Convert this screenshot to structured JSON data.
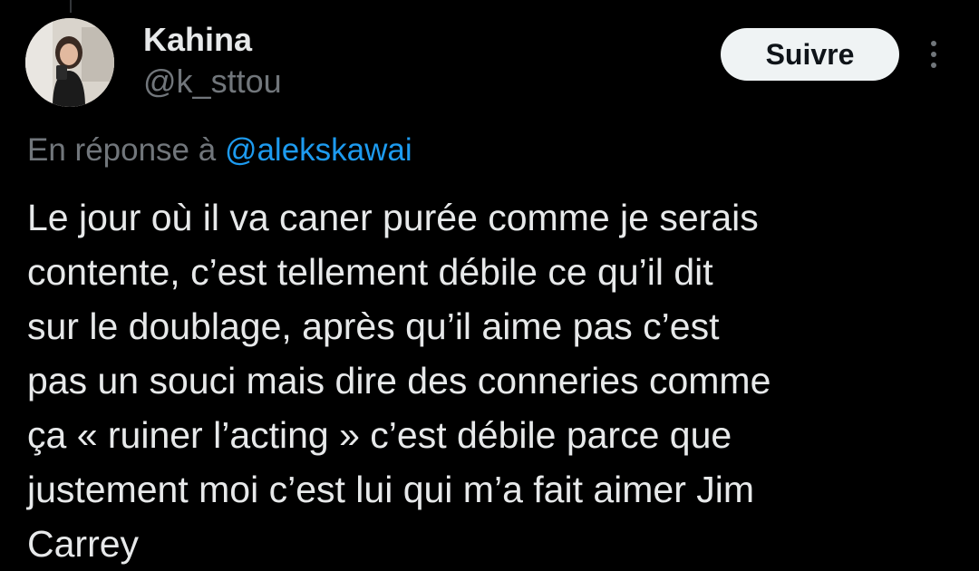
{
  "author": {
    "display_name": "Kahina",
    "handle": "@k_sttou",
    "avatar_icon": "profile-photo"
  },
  "actions": {
    "follow_label": "Suivre",
    "more_icon": "vertical-ellipsis-icon"
  },
  "reply": {
    "prefix": "En réponse à ",
    "mention": "@alekskawai"
  },
  "tweet": {
    "lines": [
      "Le jour où il va caner purée comme je serais",
      "contente, c’est tellement débile ce qu’il dit",
      "sur le doublage, après qu’il aime pas c’est",
      "pas un souci mais dire des conneries comme",
      "ça « ruiner l’acting » c’est débile parce que",
      "justement moi c’est lui qui m’a fait aimer Jim",
      "Carrey"
    ]
  },
  "colors": {
    "background": "#000000",
    "primary_text": "#e7e9ea",
    "secondary_text": "#71767b",
    "link": "#1d9bf0",
    "button_bg": "#eff3f4",
    "button_text": "#0f1419"
  }
}
